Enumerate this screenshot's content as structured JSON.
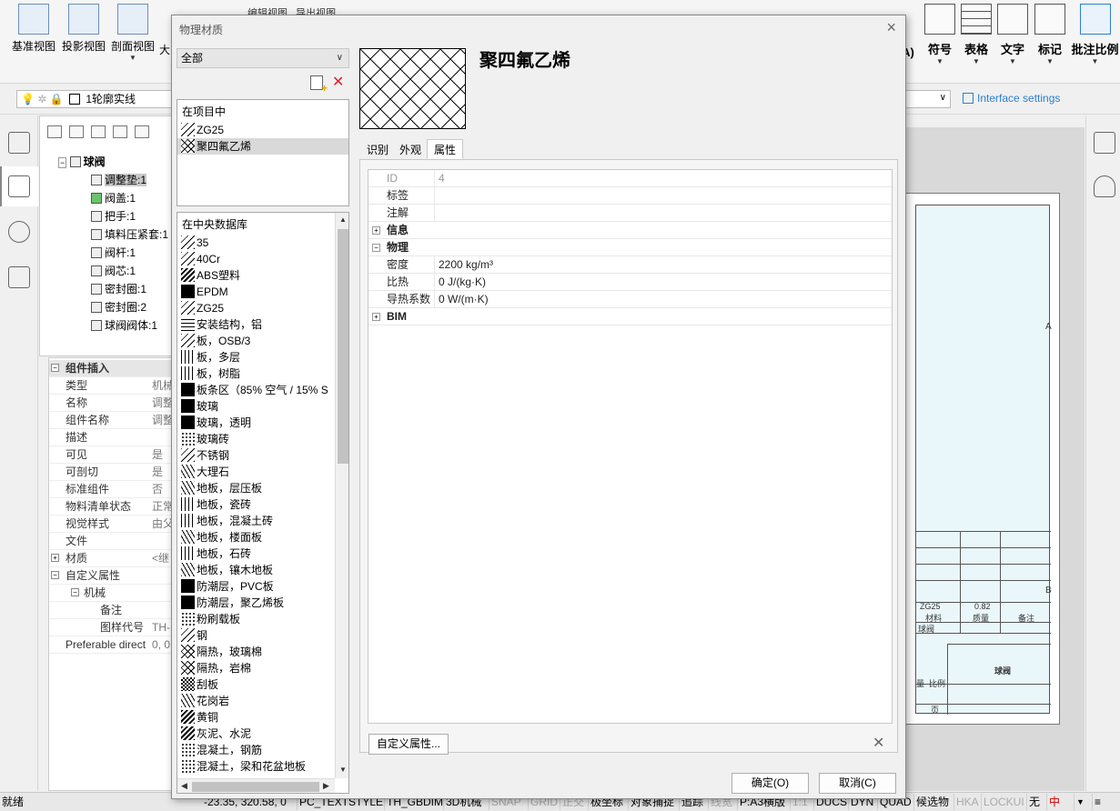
{
  "ribbon": {
    "left": [
      "基准视图",
      "投影视图",
      "剖面视图",
      "大"
    ],
    "right": [
      "A)",
      "符号",
      "表格",
      "文字",
      "标记",
      "批注比例"
    ],
    "top_partial": [
      "编辑视图",
      "导出视图"
    ]
  },
  "layer": {
    "label": "1轮廓实线"
  },
  "interface_settings": "Interface settings",
  "tree": {
    "root": "球阀",
    "items": [
      "调整垫:1",
      "阀盖:1",
      "把手:1",
      "填料压紧套:1",
      "阀杆:1",
      "阀芯:1",
      "密封圈:1",
      "密封圈:2",
      "球阀阀体:1"
    ]
  },
  "props": {
    "header": "组件插入",
    "rows": [
      {
        "k": "类型",
        "v": "机械"
      },
      {
        "k": "名称",
        "v": "调整"
      },
      {
        "k": "组件名称",
        "v": "调整"
      },
      {
        "k": "描述",
        "v": ""
      },
      {
        "k": "可见",
        "v": "是"
      },
      {
        "k": "可剖切",
        "v": "是"
      },
      {
        "k": "标准组件",
        "v": "否"
      },
      {
        "k": "物料清单状态",
        "v": "正常"
      },
      {
        "k": "视觉样式",
        "v": "由父"
      },
      {
        "k": "文件",
        "v": ""
      },
      {
        "k": "材质",
        "v": "<继"
      },
      {
        "k": "自定义属性",
        "v": ""
      },
      {
        "k": "机械",
        "v": ""
      },
      {
        "k": "备注",
        "v": ""
      },
      {
        "k": "图样代号",
        "v": "TH-"
      },
      {
        "k": "Preferable direct",
        "v": "0, 0"
      }
    ]
  },
  "dialog": {
    "title": "物理材质",
    "filter": "全部",
    "project_header": "在项目中",
    "project_items": [
      "ZG25",
      "聚四氟乙烯"
    ],
    "db_header": "在中央数据库",
    "db_items": [
      "35",
      "40Cr",
      "ABS塑料",
      "EPDM",
      "ZG25",
      "安装结构，铝",
      "板，OSB/3",
      "板，多层",
      "板，树脂",
      "板条区（85% 空气 / 15% S",
      "玻璃",
      "玻璃，透明",
      "玻璃砖",
      "不锈钢",
      "大理石",
      "地板，层压板",
      "地板，瓷砖",
      "地板，混凝土砖",
      "地板，楼面板",
      "地板，石砖",
      "地板，镶木地板",
      "防潮层，PVC板",
      "防潮层，聚乙烯板",
      "粉刷载板",
      "钢",
      "隔热，玻璃棉",
      "隔热，岩棉",
      "刮板",
      "花岗岩",
      "黄铜",
      "灰泥、水泥",
      "混凝土，钢筋",
      "混凝土，梁和花盆地板"
    ],
    "material_name": "聚四氟乙烯",
    "tabs": [
      "识别",
      "外观",
      "属性"
    ],
    "grid": {
      "id_key": "ID",
      "id_val": "4",
      "tag_key": "标签",
      "note_key": "注解",
      "info_group": "信息",
      "phys_group": "物理",
      "density_key": "密度",
      "density_val": "2200 kg/m³",
      "heat_key": "比热",
      "heat_val": "0 J/(kg·K)",
      "cond_key": "导热系数",
      "cond_val": "0 W/(m·K)",
      "bim_group": "BIM"
    },
    "custom_btn": "自定义属性...",
    "ok": "确定(O)",
    "cancel": "取消(C)"
  },
  "sheet": {
    "material": "ZG25",
    "mass": "0.82",
    "lbl_material": "材料",
    "lbl_mass": "质量",
    "lbl_note": "备注",
    "row_label": "球阀",
    "title": "球阀",
    "scale_labels": [
      "量",
      "比例"
    ],
    "page": "页",
    "zone_a": "A",
    "zone_b": "B"
  },
  "status": {
    "ready": "就绪",
    "coords": "-23.35, 320.58, 0",
    "buttons": [
      {
        "t": "PC_TEXTSTYLE",
        "on": true
      },
      {
        "t": "TH_GBDIM",
        "on": true
      },
      {
        "t": "3D机械",
        "on": true
      },
      {
        "t": "SNAP",
        "on": false
      },
      {
        "t": "GRID",
        "on": false
      },
      {
        "t": "正交",
        "on": false
      },
      {
        "t": "极坐标",
        "on": true
      },
      {
        "t": "对象捕捉",
        "on": true
      },
      {
        "t": "追踪",
        "on": true
      },
      {
        "t": "线宽",
        "on": false
      },
      {
        "t": "P:A3横版",
        "on": true
      },
      {
        "t": "1:1",
        "on": false
      },
      {
        "t": "DUCS",
        "on": true
      },
      {
        "t": "DYN",
        "on": true
      },
      {
        "t": "QUAD",
        "on": true
      },
      {
        "t": "候选物",
        "on": true
      },
      {
        "t": "HKA",
        "on": false
      },
      {
        "t": "LOCKUI",
        "on": false
      },
      {
        "t": "无",
        "on": true
      }
    ]
  }
}
